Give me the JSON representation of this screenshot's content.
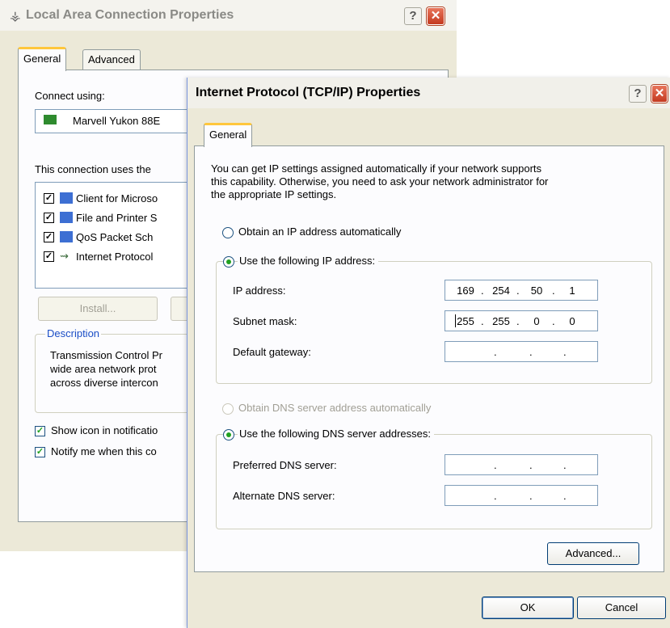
{
  "back_dialog": {
    "title": "Local Area Connection Properties",
    "help_label": "?",
    "close_label": "✕",
    "tabs": [
      "General",
      "Advanced"
    ],
    "connect_using_label": "Connect using:",
    "adapter_name": "Marvell Yukon 88E",
    "uses_label": "This connection uses the",
    "components": [
      {
        "label": "Client for Microso",
        "checked": true,
        "icon": "network-client-icon"
      },
      {
        "label": "File and Printer S",
        "checked": true,
        "icon": "file-printer-sharing-icon"
      },
      {
        "label": "QoS Packet Sch",
        "checked": true,
        "icon": "qos-scheduler-icon"
      },
      {
        "label": "Internet Protocol",
        "checked": true,
        "icon": "protocol-icon"
      }
    ],
    "install_label": "Install...",
    "description_legend": "Description",
    "description_lines": [
      "Transmission Control Pr",
      "wide area network prot",
      "across diverse intercon"
    ],
    "show_icon_label": "Show icon in notificatio",
    "notify_label": "Notify me when this co"
  },
  "front_dialog": {
    "title": "Internet Protocol (TCP/IP) Properties",
    "help_label": "?",
    "close_label": "✕",
    "tab": "General",
    "intro_lines": [
      "You can get IP settings assigned automatically if your network supports",
      "this capability. Otherwise, you need to ask your network administrator for",
      "the appropriate IP settings."
    ],
    "obtain_ip_auto": "Obtain an IP address automatically",
    "use_following_ip": "Use the following IP address:",
    "ip_address_label": "IP address:",
    "ip_address": [
      "169",
      "254",
      "50",
      "1"
    ],
    "subnet_mask_label": "Subnet mask:",
    "subnet_mask": [
      "255",
      "255",
      "0",
      "0"
    ],
    "default_gateway_label": "Default gateway:",
    "default_gateway": [
      "",
      "",
      "",
      ""
    ],
    "obtain_dns_auto": "Obtain DNS server address automatically",
    "use_following_dns": "Use the following DNS server addresses:",
    "preferred_dns_label": "Preferred DNS server:",
    "preferred_dns": [
      "",
      "",
      "",
      ""
    ],
    "alternate_dns_label": "Alternate DNS server:",
    "alternate_dns": [
      "",
      "",
      "",
      ""
    ],
    "advanced_label": "Advanced...",
    "ok_label": "OK",
    "cancel_label": "Cancel"
  },
  "colors": {
    "accent_tab": "#ffc73c",
    "radio_dot": "#21a121",
    "close_button": "#c4391f"
  }
}
